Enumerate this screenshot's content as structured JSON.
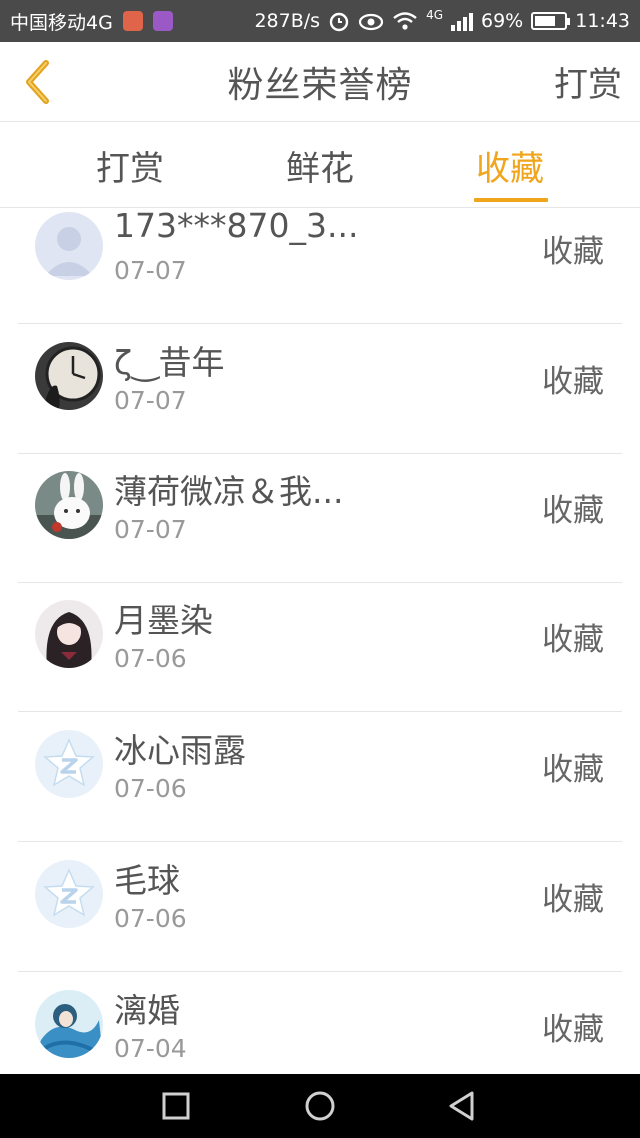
{
  "status_bar": {
    "carrier": "中国移动4G",
    "speed": "287B/s",
    "network_small": "4G",
    "battery_percent": "69%",
    "battery_level": 0.69,
    "time": "11:43"
  },
  "header": {
    "title": "粉丝荣誉榜",
    "action_label": "打赏"
  },
  "tabs": [
    {
      "label": "打赏",
      "active": false
    },
    {
      "label": "鲜花",
      "active": false
    },
    {
      "label": "收藏",
      "active": true
    }
  ],
  "list": [
    {
      "name": "173***870_3...",
      "date": "07-07",
      "tag": "收藏",
      "avatar": "default-person"
    },
    {
      "name": "ζ⁠‿昔年",
      "date": "07-07",
      "tag": "收藏",
      "avatar": "clock-photo"
    },
    {
      "name": "薄荷微凉＆我...",
      "date": "07-07",
      "tag": "收藏",
      "avatar": "rabbit-photo"
    },
    {
      "name": "月墨染",
      "date": "07-06",
      "tag": "收藏",
      "avatar": "anime-girl"
    },
    {
      "name": "冰心雨露",
      "date": "07-06",
      "tag": "收藏",
      "avatar": "qzone-star"
    },
    {
      "name": "毛球",
      "date": "07-06",
      "tag": "收藏",
      "avatar": "qzone-star"
    },
    {
      "name": "漓婚",
      "date": "07-04",
      "tag": "收藏",
      "avatar": "blue-anime"
    }
  ],
  "colors": {
    "accent": "#f0a51c",
    "text": "#555555",
    "subtext": "#999999",
    "divider": "#e6e6e6",
    "status_bar": "#4a4a4a"
  }
}
